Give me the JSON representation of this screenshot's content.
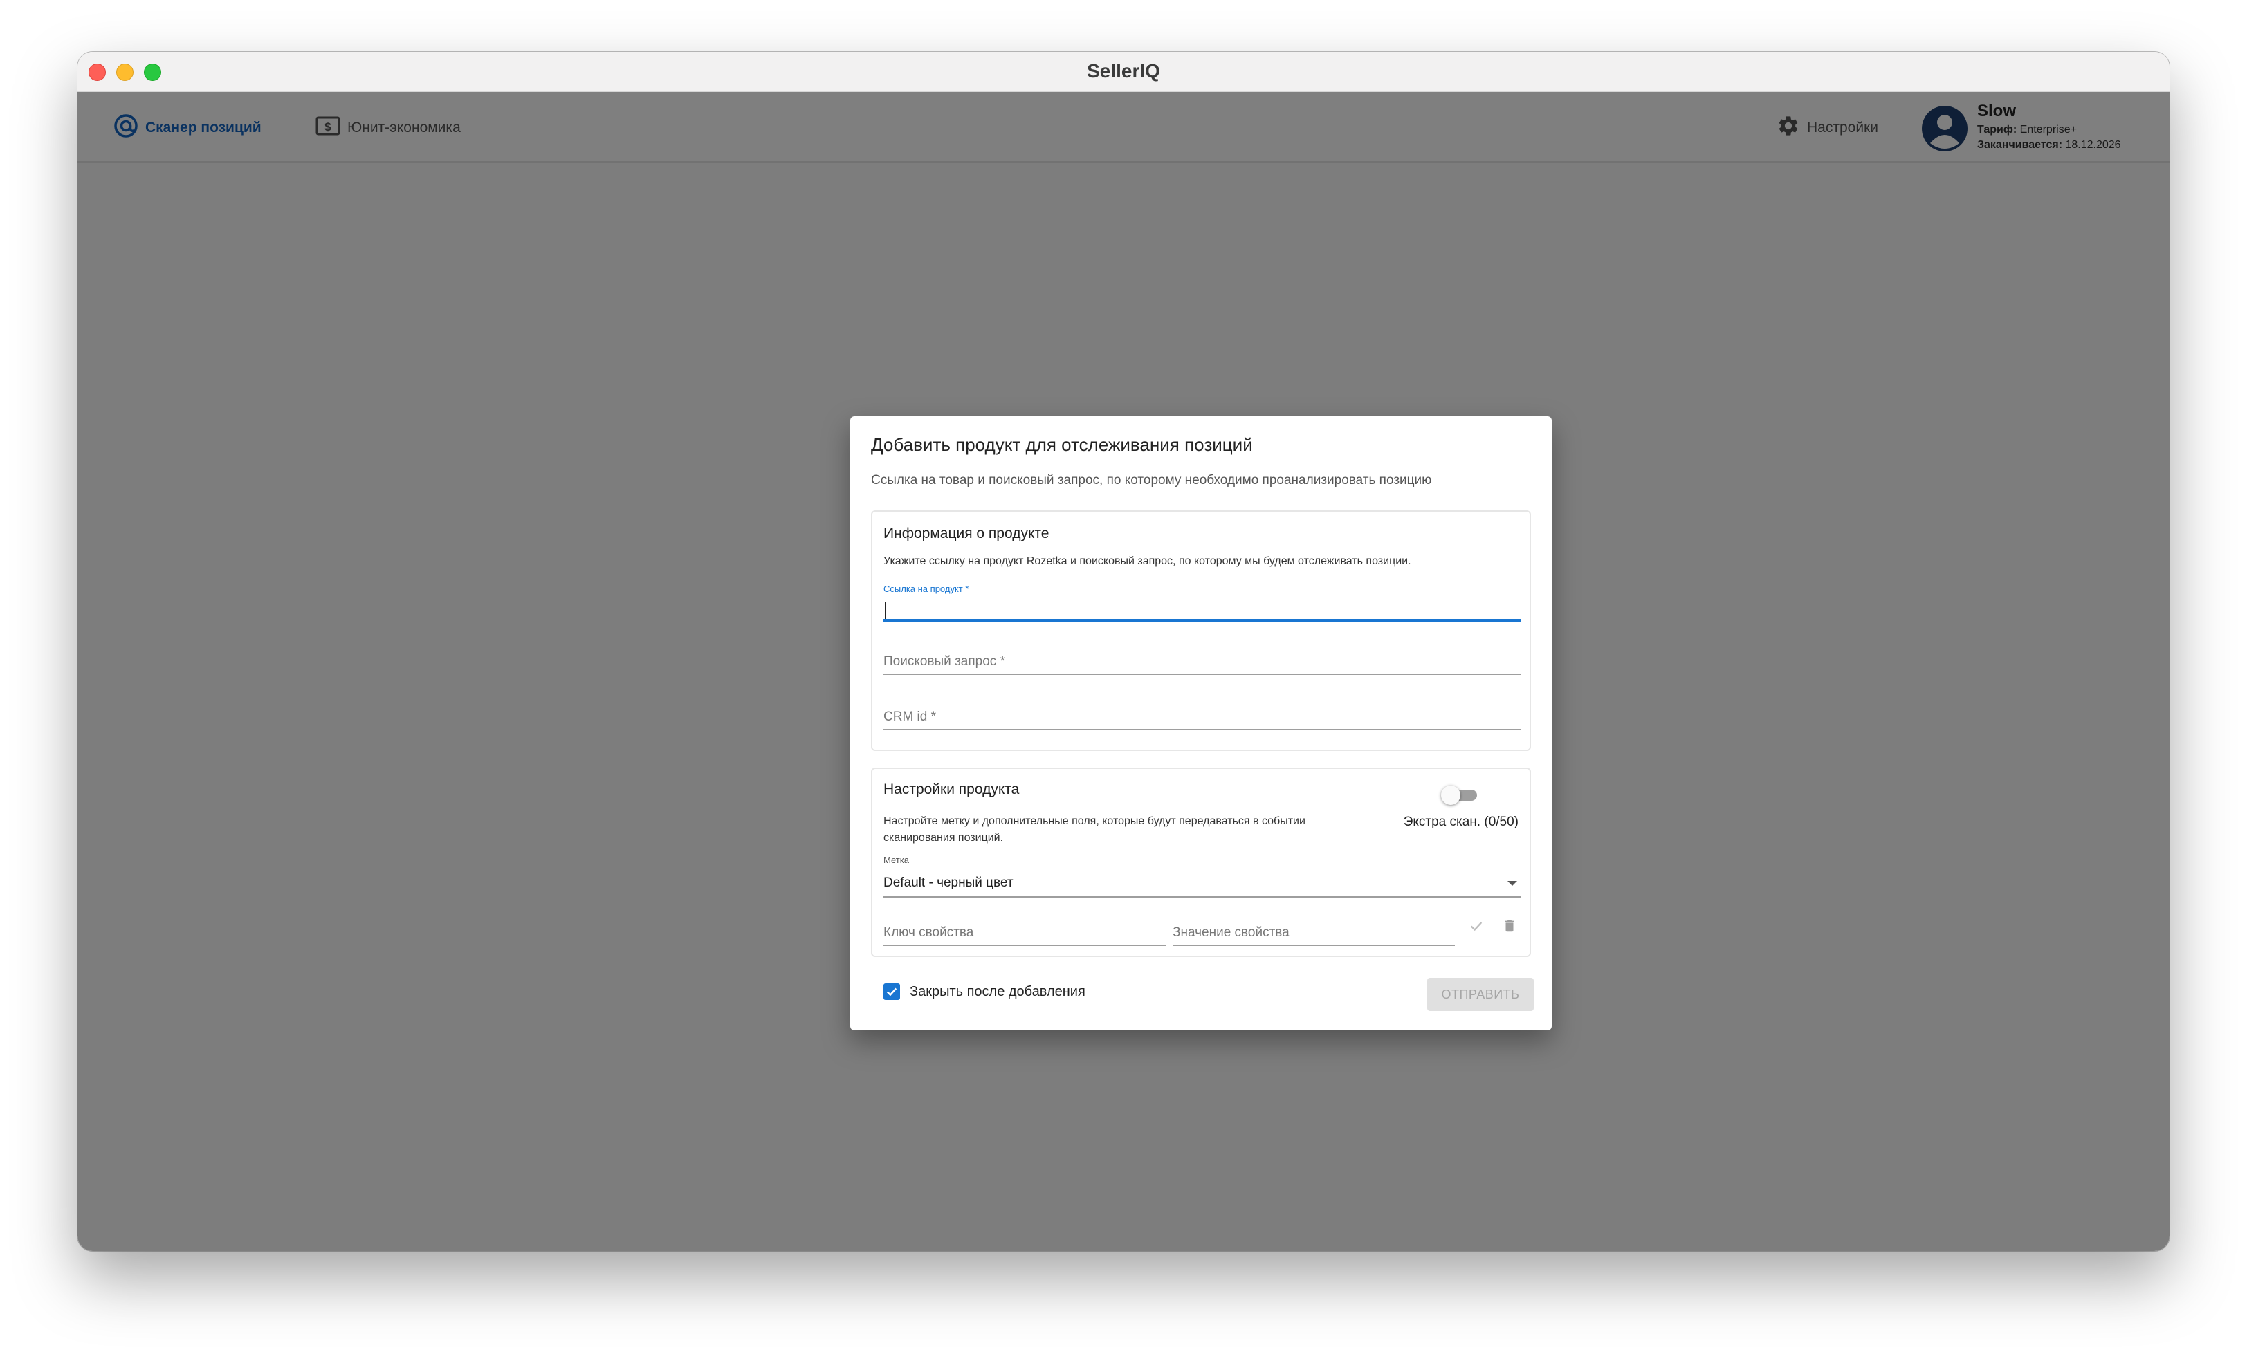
{
  "window": {
    "title": "SellerIQ"
  },
  "nav": {
    "scanner_label": "Сканер позиций",
    "unit_label": "Юнит-экономика",
    "settings_label": "Настройки"
  },
  "user": {
    "name": "Slow",
    "plan_label": "Тариф:",
    "plan_value": "Enterprise+",
    "expires_label": "Заканчивается:",
    "expires_value": "18.12.2026"
  },
  "dialog": {
    "title": "Добавить продукт для отслеживания позиций",
    "subtitle": "Ссылка на товар и поисковый запрос, по которому необходимо проанализировать позицию",
    "product_info": {
      "title": "Информация о продукте",
      "description": "Укажите ссылку на продукт Rozetka и поисковый запрос, по которому мы будем отслеживать позиции.",
      "link_label": "Ссылка на продукт *",
      "link_value": "",
      "query_placeholder": "Поисковый запрос *",
      "crm_placeholder": "CRM id *"
    },
    "product_settings": {
      "title": "Настройки продукта",
      "description": "Настройте метку и дополнительные поля, которые будут передаваться в событии сканирования позиций.",
      "extra_scan_label": "Экстра скан. (0/50)",
      "extra_scan_enabled": false,
      "tag_label": "Метка",
      "tag_value": "Default - черный цвет",
      "prop_key_placeholder": "Ключ свойства",
      "prop_value_placeholder": "Значение свойства"
    },
    "close_after_label": "Закрыть после добавления",
    "close_after_checked": true,
    "submit_label": "ОТПРАВИТЬ"
  },
  "colors": {
    "accent": "#1976d2",
    "nav_active": "#1565c0",
    "overlay": "rgba(0,0,0,0.5)"
  },
  "icons": [
    "at-target-icon",
    "dollar-box-icon",
    "gear-icon",
    "account-circle-icon",
    "chevron-down-icon",
    "check-icon",
    "trash-icon",
    "checkbox-checked-icon"
  ]
}
